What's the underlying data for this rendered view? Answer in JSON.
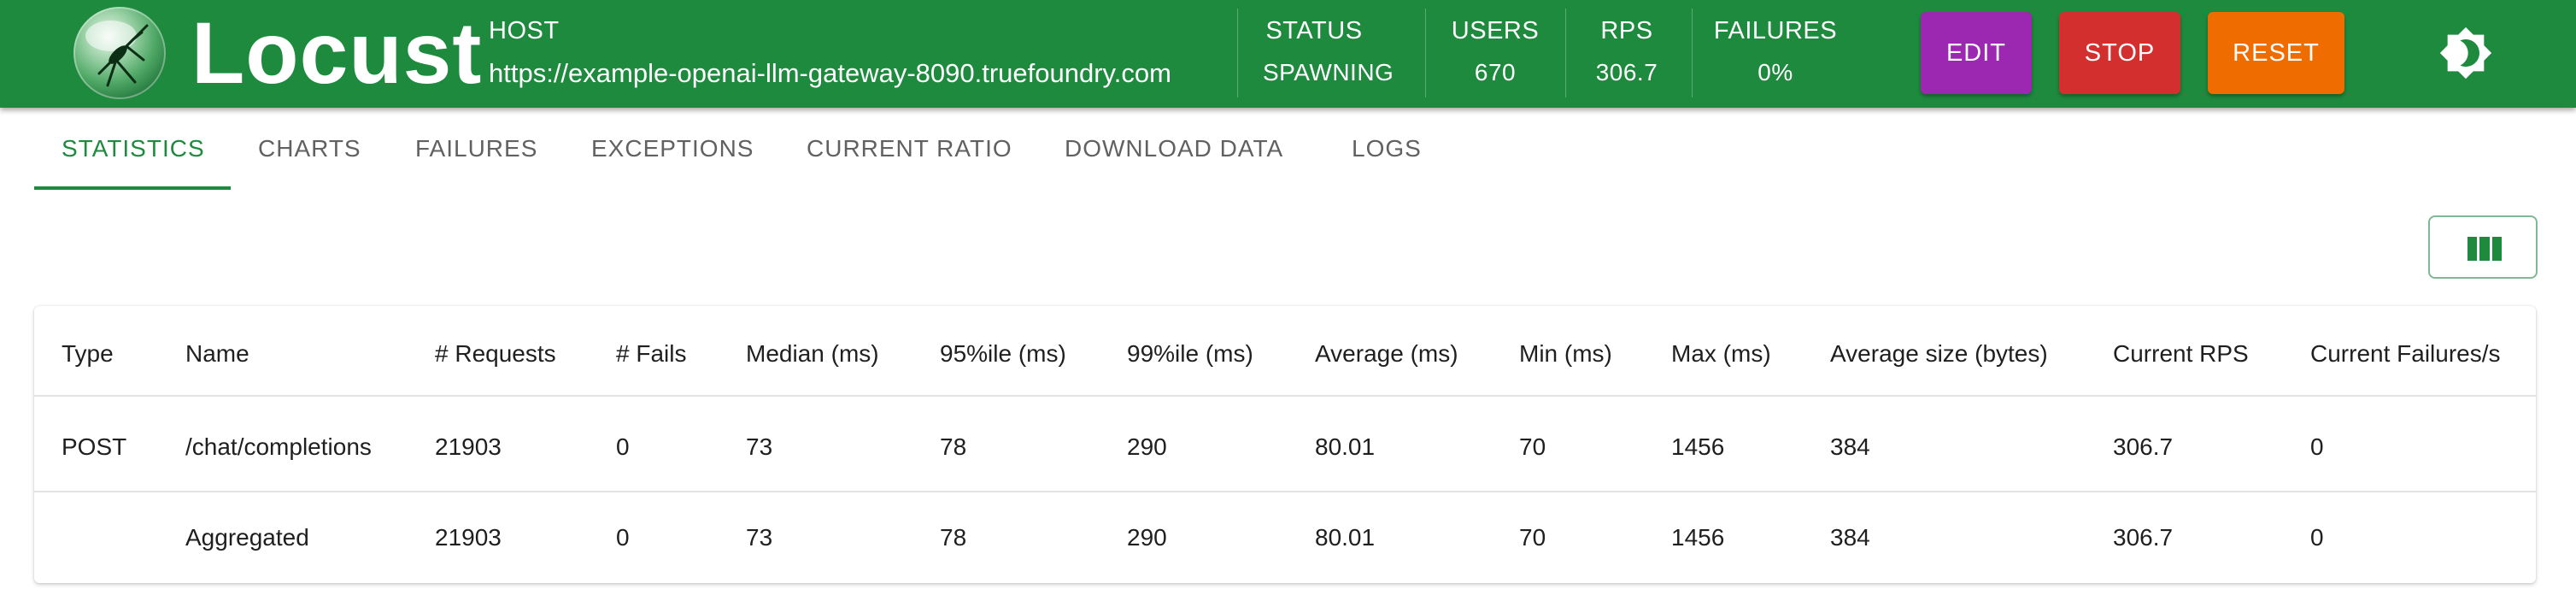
{
  "app": {
    "brand": "Locust",
    "host_label": "HOST",
    "host_url": "https://example-openai-llm-gateway-8090.truefoundry.com"
  },
  "stats": [
    {
      "label": "STATUS",
      "value": "SPAWNING"
    },
    {
      "label": "USERS",
      "value": "670"
    },
    {
      "label": "RPS",
      "value": "306.7"
    },
    {
      "label": "FAILURES",
      "value": "0%"
    }
  ],
  "buttons": {
    "edit": "EDIT",
    "stop": "STOP",
    "reset": "RESET"
  },
  "colors": {
    "header": "#1e8a3e",
    "edit": "#9c27b0",
    "stop": "#d32f2f",
    "reset": "#ef6c00"
  },
  "tabs": [
    {
      "label": "STATISTICS",
      "active": true
    },
    {
      "label": "CHARTS",
      "active": false
    },
    {
      "label": "FAILURES",
      "active": false
    },
    {
      "label": "EXCEPTIONS",
      "active": false
    },
    {
      "label": "CURRENT RATIO",
      "active": false
    },
    {
      "label": "DOWNLOAD DATA",
      "active": false
    },
    {
      "label": "LOGS",
      "active": false
    }
  ],
  "icons": {
    "theme_toggle": "brightness-icon",
    "columns": "view-column-icon"
  },
  "table": {
    "columns": [
      "Type",
      "Name",
      "# Requests",
      "# Fails",
      "Median (ms)",
      "95%ile (ms)",
      "99%ile (ms)",
      "Average (ms)",
      "Min (ms)",
      "Max (ms)",
      "Average size (bytes)",
      "Current RPS",
      "Current Failures/s"
    ],
    "rows": [
      [
        "POST",
        "/chat/completions",
        "21903",
        "0",
        "73",
        "78",
        "290",
        "80.01",
        "70",
        "1456",
        "384",
        "306.7",
        "0"
      ],
      [
        "",
        "Aggregated",
        "21903",
        "0",
        "73",
        "78",
        "290",
        "80.01",
        "70",
        "1456",
        "384",
        "306.7",
        "0"
      ]
    ]
  }
}
